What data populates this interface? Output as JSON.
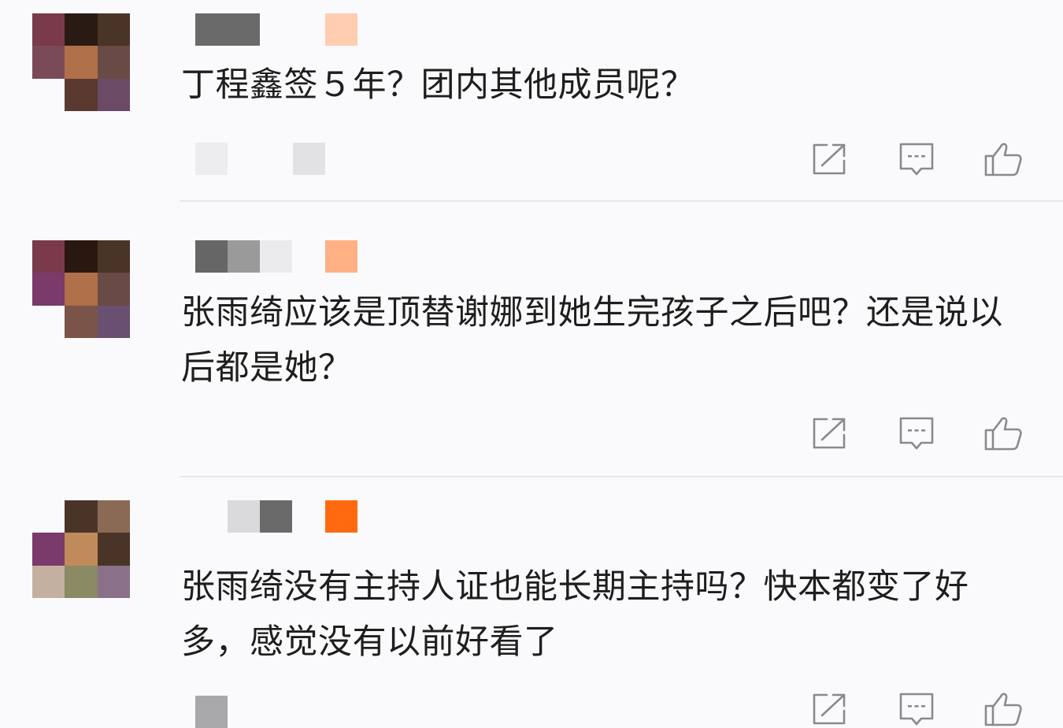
{
  "comments": [
    {
      "text": "丁程鑫签５年？团内其他成员呢？",
      "avatar_colors": [
        "#7a3a4a",
        "#2a1a14",
        "#4a3428",
        "#7a4a58",
        "#b0704a",
        "#6a4a44",
        "#fafafc",
        "#5a3a30",
        "#6a4a64"
      ],
      "name_blocks": [
        {
          "color": "#6a6a6a"
        },
        {
          "color": "#6a6a6a"
        },
        {
          "color": "#fafafc"
        },
        {
          "color": "#ffcdb0"
        }
      ],
      "meta_blocks": [
        {
          "color": "#ededf0"
        },
        {
          "color": "#fafafc"
        },
        {
          "color": "#e2e2e5"
        }
      ],
      "actions": {
        "share": "share-icon",
        "reply": "comment-icon",
        "like": "thumbs-up-icon"
      }
    },
    {
      "text": "张雨绮应该是顶替谢娜到她生完孩子之后吧？还是说以后都是她？",
      "avatar_colors": [
        "#7a3a4a",
        "#2a1810",
        "#4a3428",
        "#7a3a6a",
        "#b0704a",
        "#6a4a44",
        "#fafafc",
        "#7a5448",
        "#6a5070"
      ],
      "name_blocks": [
        {
          "color": "#666666"
        },
        {
          "color": "#9a9a9a"
        },
        {
          "color": "#ebebee"
        },
        {
          "color": "#ffb084"
        }
      ],
      "meta_blocks": [],
      "actions": {
        "share": "share-icon",
        "reply": "comment-icon",
        "like": "thumbs-up-icon"
      }
    },
    {
      "text": "张雨绮没有主持人证也能长期主持吗？快本都变了好多，感觉没有以前好看了",
      "avatar_colors": [
        "#fafafc",
        "#4a3428",
        "#8a6a54",
        "#7a3a6a",
        "#c08a5a",
        "#4a3428",
        "#c4b0a0",
        "#8a8a64",
        "#8a7088"
      ],
      "name_blocks": [
        {
          "color": "#fafafc"
        },
        {
          "color": "#dadadc"
        },
        {
          "color": "#6a6a6a"
        },
        {
          "color": "#ff6a10"
        }
      ],
      "meta_blocks": [
        {
          "color": "#a8a8aa"
        }
      ],
      "actions": {
        "share": "share-icon",
        "reply": "comment-icon",
        "like": "thumbs-up-icon"
      }
    }
  ],
  "icon_color": "#8a8a8e"
}
